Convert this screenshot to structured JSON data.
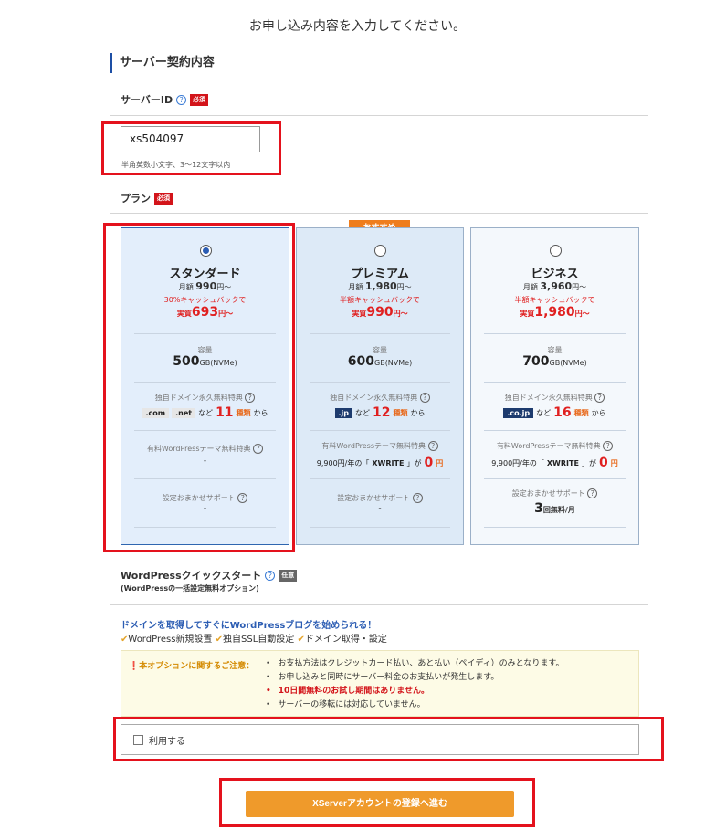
{
  "page": {
    "heading": "お申し込み内容を入力してください。"
  },
  "section": {
    "title": "サーバー契約内容"
  },
  "server_id": {
    "label": "サーバーID",
    "required_badge": "必須",
    "value": "xs504097",
    "hint": "半角英数小文字、3〜12文字以内"
  },
  "plan_section": {
    "label": "プラン",
    "required_badge": "必須",
    "recommend_badge": "おすすめ"
  },
  "plans": [
    {
      "name": "スタンダード",
      "selected": true,
      "price_prefix": "月額",
      "price": "990",
      "price_suffix": "円〜",
      "cashback": "30%キャッシュバックで",
      "effective_prefix": "実質",
      "effective": "693",
      "effective_suffix": "円〜",
      "capacity_label": "容量",
      "capacity": "500",
      "capacity_unit": "GB(NVMe)",
      "domain_label": "独自ドメイン永久無料特典",
      "domains": [
        ".com",
        ".net"
      ],
      "domain_mid": "など",
      "domain_count": "11",
      "domain_count_unit": "種類",
      "domain_tail": "から",
      "theme_label": "有料WordPressテーマ無料特典",
      "theme_value": "-",
      "support_label": "設定おまかせサポート",
      "support_value": "-"
    },
    {
      "name": "プレミアム",
      "selected": false,
      "price_prefix": "月額",
      "price": "1,980",
      "price_suffix": "円〜",
      "cashback": "半額キャッシュバックで",
      "effective_prefix": "実質",
      "effective": "990",
      "effective_suffix": "円〜",
      "capacity_label": "容量",
      "capacity": "600",
      "capacity_unit": "GB(NVMe)",
      "domain_label": "独自ドメイン永久無料特典",
      "domains": [
        ".jp"
      ],
      "domain_mid": "など",
      "domain_count": "12",
      "domain_count_unit": "種類",
      "domain_tail": "から",
      "theme_label": "有料WordPressテーマ無料特典",
      "theme_price": "9,900円/年の「",
      "theme_name": "XWRITE",
      "theme_mid": "」が",
      "theme_free": "0",
      "theme_free_unit": "円",
      "support_label": "設定おまかせサポート",
      "support_value": "-"
    },
    {
      "name": "ビジネス",
      "selected": false,
      "price_prefix": "月額",
      "price": "3,960",
      "price_suffix": "円〜",
      "cashback": "半額キャッシュバックで",
      "effective_prefix": "実質",
      "effective": "1,980",
      "effective_suffix": "円〜",
      "capacity_label": "容量",
      "capacity": "700",
      "capacity_unit": "GB(NVMe)",
      "domain_label": "独自ドメイン永久無料特典",
      "domains": [
        ".co.jp"
      ],
      "domain_mid": "など",
      "domain_count": "16",
      "domain_count_unit": "種類",
      "domain_tail": "から",
      "theme_label": "有料WordPressテーマ無料特典",
      "theme_price": "9,900円/年の「",
      "theme_name": "XWRITE",
      "theme_mid": "」が",
      "theme_free": "0",
      "theme_free_unit": "円",
      "support_label": "設定おまかせサポート",
      "support_count": "3",
      "support_unit": "回無料/月"
    }
  ],
  "quickstart": {
    "label": "WordPressクイックスタート",
    "optional_badge": "任意",
    "sub": "(WordPressの一括設定無料オプション)",
    "promo": "ドメインを取得してすぐにWordPressブログを始められる！",
    "features": [
      "WordPress新規設置",
      "独自SSL自動設定",
      "ドメイン取得・設定"
    ],
    "notice_title": "本オプションに関するご注意：",
    "notices": [
      "お支払方法はクレジットカード払い、あと払い（ペイディ）のみとなります。",
      "お申し込みと同時にサーバー料金のお支払いが発生します。",
      "10日間無料のお試し期間はありません。",
      "サーバーの移転には対応していません。"
    ],
    "checkbox_label": "利用する",
    "checked": false
  },
  "submit": {
    "label": "XServerアカウントの登録へ進む"
  },
  "colors": {
    "accent": "#2c5db3",
    "red": "#e02020",
    "orange": "#ef9a2b",
    "highlight": "#e4121d"
  }
}
